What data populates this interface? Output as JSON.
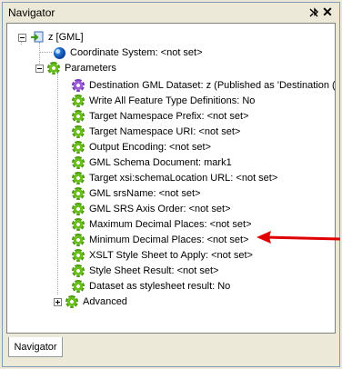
{
  "window": {
    "title": "Navigator"
  },
  "tree": {
    "root": "z [GML]",
    "coordinate_system": "Coordinate System: <not set>",
    "parameters": "Parameters",
    "items": [
      "Destination GML Dataset: z (Published as 'Destination (",
      "Write All Feature Type Definitions: No",
      "Target Namespace Prefix: <not set>",
      "Target Namespace URI: <not set>",
      "Output Encoding: <not set>",
      "GML Schema Document: mark1",
      "Target xsi:schemaLocation URL: <not set>",
      "GML srsName: <not set>",
      "GML SRS Axis Order: <not set>",
      "Maximum Decimal Places: <not set>",
      "Minimum Decimal Places: <not set>",
      "XSLT Style Sheet to Apply: <not set>",
      "Style Sheet Result: <not set>",
      "Dataset as stylesheet result: No"
    ],
    "advanced": "Advanced"
  },
  "tabs": {
    "navigator": "Navigator"
  },
  "colors": {
    "arrow": "#e00000",
    "gear_green": "#4f9e13",
    "gear_purple": "#7a3cc0"
  },
  "icons": {
    "root": "dataset-icon",
    "coordinate_system": "globe-icon",
    "parameters": "gear-icon",
    "first_item": "purple-gear-icon",
    "items": "gear-icon"
  }
}
